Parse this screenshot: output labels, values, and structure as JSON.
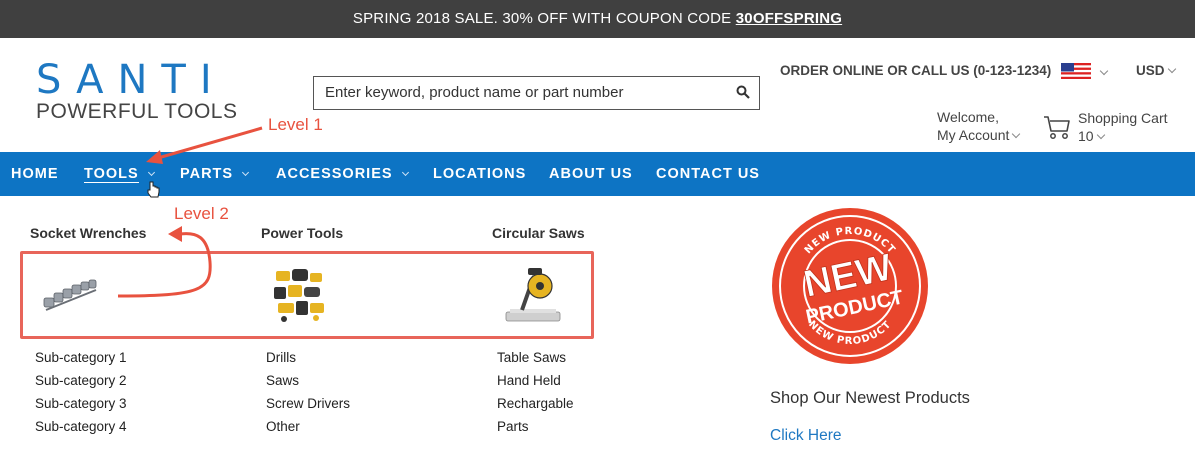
{
  "promo_bar": {
    "text": "SPRING 2018 SALE. 30% OFF WITH COUPON CODE ",
    "code": "30OFFSPRING"
  },
  "logo": {
    "main": "SANTI",
    "sub": "POWERFUL TOOLS",
    "color": "#1e78c2"
  },
  "search": {
    "placeholder": "Enter keyword, product name or part number",
    "icon": "search-icon"
  },
  "header": {
    "order_line": "ORDER ONLINE OR CALL US (0-123-1234)",
    "flag_icon": "us-flag-icon",
    "currency": "USD",
    "welcome": "Welcome,",
    "account": "My Account",
    "cart_label": "Shopping Cart",
    "cart_count": "10",
    "cart_icon": "shopping-cart-icon"
  },
  "annotations": {
    "level1": "Level 1",
    "level2": "Level 2",
    "color": "#e8523f"
  },
  "nav": {
    "color": "#0d74c4",
    "items": [
      {
        "label": "HOME"
      },
      {
        "label": "TOOLS"
      },
      {
        "label": "PARTS"
      },
      {
        "label": "ACCESSORIES"
      },
      {
        "label": "LOCATIONS"
      },
      {
        "label": "ABOUT US"
      },
      {
        "label": "CONTACT US"
      }
    ]
  },
  "mega_menu": {
    "columns": [
      {
        "title": "Socket Wrenches",
        "image": "socket-wrench-set-image",
        "items": [
          "Sub-category 1",
          "Sub-category 2",
          "Sub-category 3",
          "Sub-category 4"
        ]
      },
      {
        "title": "Power Tools",
        "image": "power-tools-set-image",
        "items": [
          "Drills",
          "Saws",
          "Screw Drivers",
          "Other"
        ]
      },
      {
        "title": "Circular Saws",
        "image": "miter-saw-image",
        "items": [
          "Table Saws",
          "Hand Held",
          "Rechargable",
          "Parts"
        ]
      }
    ],
    "featured": {
      "stamp_text_1": "NEW",
      "stamp_text_2": "PRODUCT",
      "stamp_ring_text": "NEW PRODUCT",
      "stamp_color": "#e8452c",
      "title": "Shop Our Newest Products",
      "link": "Click Here"
    }
  }
}
